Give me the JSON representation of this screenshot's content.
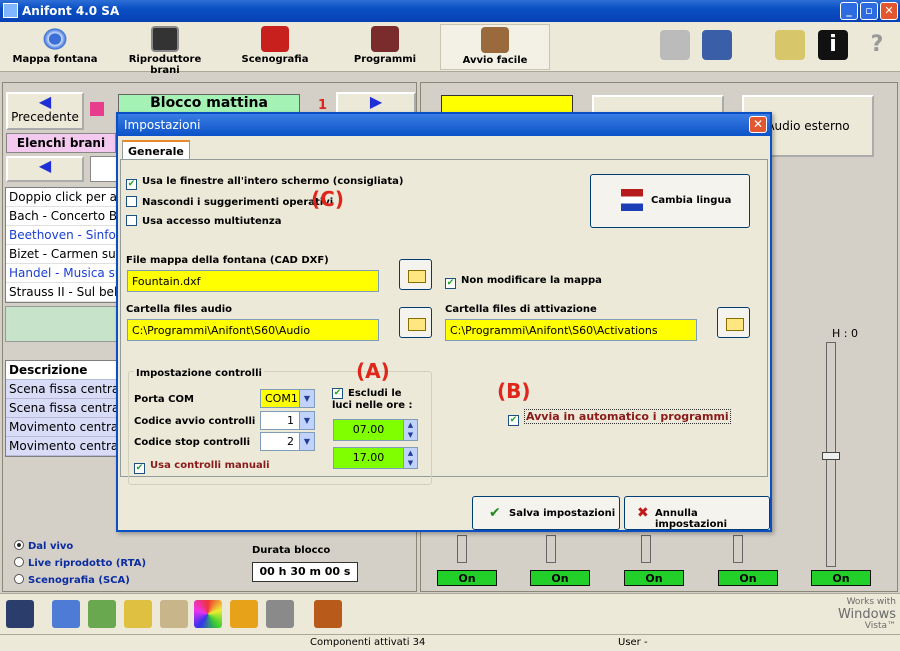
{
  "window": {
    "title": "Anifont 4.0 SA",
    "min": "_",
    "max": "▫",
    "close": "✕"
  },
  "toolbar": {
    "items": [
      {
        "label": "Mappa fontana"
      },
      {
        "label": "Riproduttore brani"
      },
      {
        "label": "Scenografia"
      },
      {
        "label": "Programmi"
      },
      {
        "label": "Avvio facile"
      }
    ],
    "info": "i",
    "help": "?"
  },
  "left": {
    "prev_label": "Precedente",
    "block_title": "Blocco mattina",
    "elenchi_label": "Elenchi brani",
    "number": "1",
    "list": [
      "Doppio click per a",
      "Bach - Concerto Bi",
      "Beethoven - Sinfon",
      "Bizet - Carmen sui",
      "Handel - Musica su",
      "Strauss II - Sul bel"
    ],
    "desc_header": "Descrizione",
    "desc_items": [
      "Scena fissa centra",
      "Scena fissa centra",
      "Movimento centrale",
      "Movimento centrale"
    ],
    "radios": [
      "Dal vivo",
      "Live riprodotto (RTA)",
      "Scenografia (SCA)"
    ],
    "durata_label": "Durata blocco",
    "durata_value": "00 h 30 m 00 s"
  },
  "right": {
    "audio_esterno": "Audio esterno",
    "h_label": "H : 0",
    "on_label": "On"
  },
  "dialog": {
    "title": "Impostazioni",
    "close": "✕",
    "tab": "Generale",
    "chk_fullscreen": "Usa le finestre all'intero schermo (consigliata)",
    "chk_hide": "Nascondi i suggerimenti operativi",
    "chk_multi": "Usa accesso multiutenza",
    "cambia_lingua": "Cambia lingua",
    "file_mappa_label": "File mappa della fontana (CAD DXF)",
    "file_mappa_value": "Fountain.dxf",
    "non_modificare": "Non modificare la mappa",
    "cartella_audio_label": "Cartella files audio",
    "cartella_audio_value": "C:\\Programmi\\Anifont\\S60\\Audio",
    "cartella_attiv_label": "Cartella files di attivazione",
    "cartella_attiv_value": "C:\\Programmi\\Anifont\\S60\\Activations",
    "group_title": "Impostazione controlli",
    "porta_com_label": "Porta COM",
    "porta_com_value": "COM1",
    "codice_avvio_label": "Codice avvio controlli",
    "codice_avvio_value": "1",
    "codice_stop_label": "Codice stop controlli",
    "codice_stop_value": "2",
    "usa_controlli": "Usa controlli manuali",
    "escludi_luci": "Escludi le luci nelle ore :",
    "ora_1": "07.00",
    "ora_2": "17.00",
    "avvia_auto": "Avvia in automatico i programmi",
    "salva": "Salva impostazioni",
    "annulla": "Annulla impostazioni"
  },
  "annotations": {
    "a": "(A)",
    "b": "(B)",
    "c": "(C)"
  },
  "status": {
    "componenti": "Componenti attivati 34",
    "user": "User  -"
  },
  "vista": {
    "line1": "Works with",
    "line2": "Windows",
    "line3": "Vista™"
  },
  "colors": {
    "accent_yellow": "#ffff00",
    "spin_green": "#7fff00",
    "on_green": "#23d02a",
    "annotation_red": "#e0251b"
  }
}
